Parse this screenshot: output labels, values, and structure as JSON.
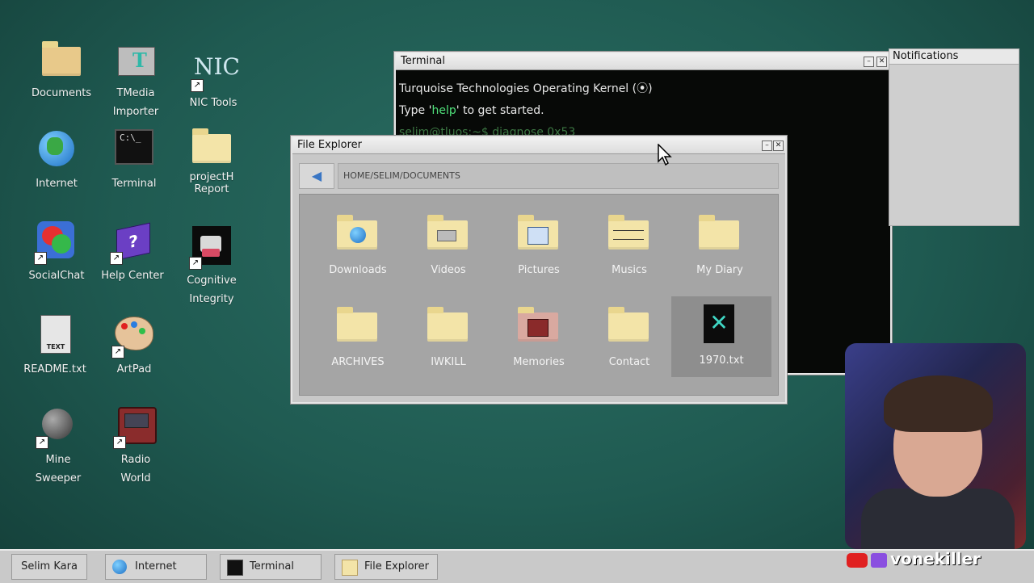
{
  "desktop": {
    "icons": [
      {
        "label": "Documents"
      },
      {
        "label": "TMedia\nImporter"
      },
      {
        "label": "NIC Tools"
      },
      {
        "label": "Internet"
      },
      {
        "label": "Terminal"
      },
      {
        "label": "projectH\nReport"
      },
      {
        "label": "SocialChat"
      },
      {
        "label": "Help Center"
      },
      {
        "label": "Cognitive\nIntegrity"
      },
      {
        "label": "README.txt"
      },
      {
        "label": "ArtPad"
      },
      {
        "label": "Mine\nSweeper"
      },
      {
        "label": "Radio\nWorld"
      }
    ]
  },
  "terminal": {
    "title": "Terminal",
    "line1": "Turquoise Technologies Operating Kernel (⦿)",
    "line2_pre": "Type '",
    "line2_help": "help",
    "line2_post": "' to get started.",
    "line3": "selim@tluos:~$ diagnose 0x53"
  },
  "notifications": {
    "title": "Notifications"
  },
  "explorer": {
    "title": "File Explorer",
    "back_glyph": "🠔",
    "path": "HOME/SELIM/DOCUMENTS",
    "items": [
      {
        "label": "Downloads"
      },
      {
        "label": "Videos"
      },
      {
        "label": "Pictures"
      },
      {
        "label": "Musics"
      },
      {
        "label": "My Diary"
      },
      {
        "label": "ARCHIVES"
      },
      {
        "label": "IWKILL"
      },
      {
        "label": "Memories"
      },
      {
        "label": "Contact"
      },
      {
        "label": "1970.txt"
      }
    ]
  },
  "taskbar": {
    "user": "Selim Kara",
    "tasks": [
      {
        "label": "Internet"
      },
      {
        "label": "Terminal"
      },
      {
        "label": "File Explorer"
      }
    ]
  },
  "overlay": {
    "handle": "vonekiller"
  },
  "colors": {
    "desktop": "#1f5a51",
    "folder": "#f3e4a8",
    "help": "#4fe07a"
  }
}
